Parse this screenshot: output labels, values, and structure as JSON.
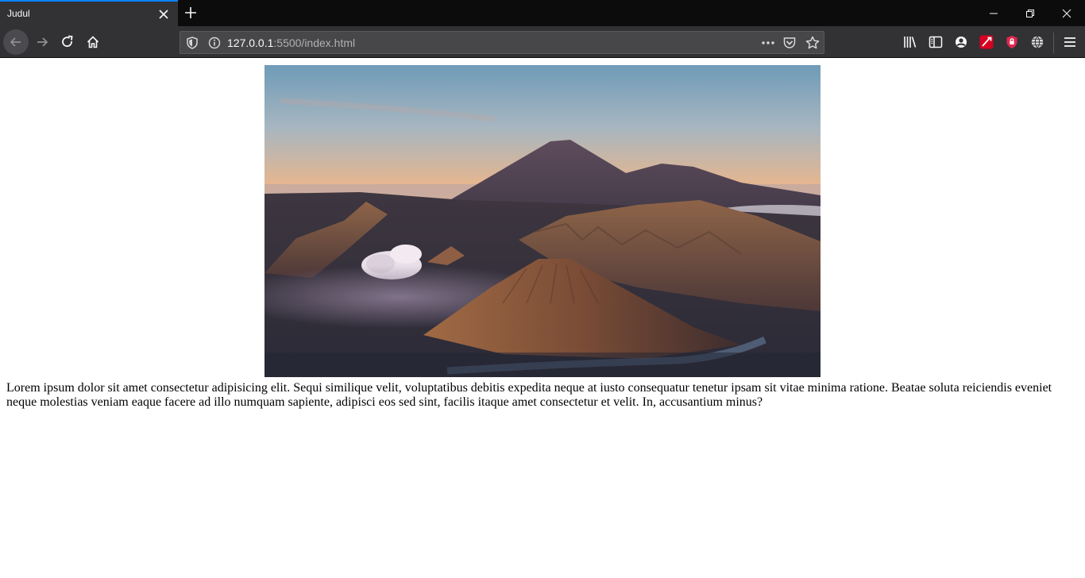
{
  "browser": {
    "tab": {
      "title": "Judul"
    },
    "url": {
      "host": "127.0.0.1",
      "rest": ":5500/index.html"
    },
    "colors": {
      "chrome_dark": "#0c0c0d",
      "toolbar": "#323234",
      "tab_accent": "#0a84ff"
    }
  },
  "page": {
    "paragraph": "Lorem ipsum dolor sit amet consectetur adipisicing elit. Sequi similique velit, voluptatibus debitis expedita neque at iusto consequatur tenetur ipsam sit vitae minima ratione. Beatae soluta reiciendis eveniet neque molestias veniam eaque facere ad illo numquam sapiente, adipisci eos sed sint, facilis itaque amet consectetur et velit. In, accusantium minus?"
  },
  "icons": {
    "back": "arrow-left-icon",
    "forward": "arrow-right-icon",
    "reload": "reload-icon",
    "home": "home-icon",
    "shield": "tracking-shield-icon",
    "info": "site-info-icon",
    "more": "page-actions-icon",
    "pocket": "pocket-icon",
    "bookmark": "bookmark-star-icon",
    "library": "library-icon",
    "sidebar": "sidebar-icon",
    "account": "account-icon",
    "menu": "hamburger-menu-icon"
  }
}
